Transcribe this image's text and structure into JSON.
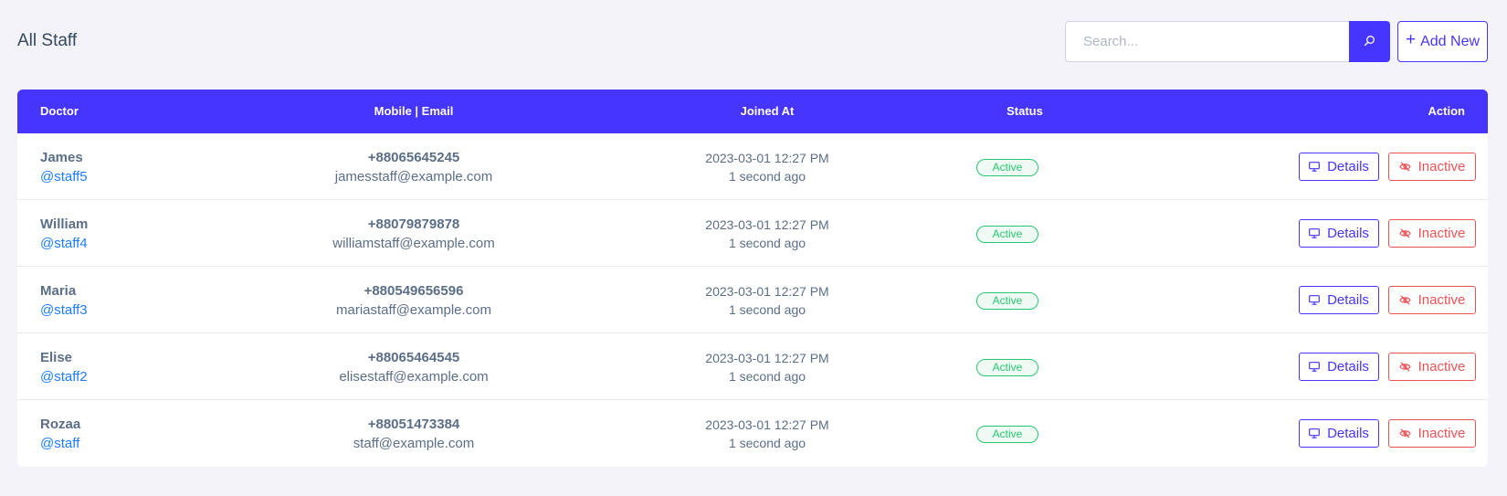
{
  "page": {
    "title": "All Staff"
  },
  "search": {
    "placeholder": "Search..."
  },
  "toolbar": {
    "add_label": "Add New",
    "add_icon": "plus-icon",
    "search_icon": "search-icon"
  },
  "colors": {
    "primary": "#4634ff",
    "success": "#28c76f",
    "danger": "#ea5455",
    "link": "#1e7cff",
    "background": "#f3f3f9"
  },
  "table": {
    "headers": {
      "doctor": "Doctor",
      "contact": "Mobile | Email",
      "joined": "Joined At",
      "status": "Status",
      "action": "Action"
    },
    "actions": {
      "details_label": "Details",
      "details_icon": "desktop-icon",
      "inactive_label": "Inactive",
      "inactive_icon": "eye-slash-icon"
    },
    "rows": [
      {
        "name": "James",
        "username": "@staff5",
        "mobile": "+88065645245",
        "email": "jamesstaff@example.com",
        "joined_date": "2023-03-01 12:27 PM",
        "joined_ago": "1 second ago",
        "status": "Active"
      },
      {
        "name": "William",
        "username": "@staff4",
        "mobile": "+88079879878",
        "email": "williamstaff@example.com",
        "joined_date": "2023-03-01 12:27 PM",
        "joined_ago": "1 second ago",
        "status": "Active"
      },
      {
        "name": "Maria",
        "username": "@staff3",
        "mobile": "+880549656596",
        "email": "mariastaff@example.com",
        "joined_date": "2023-03-01 12:27 PM",
        "joined_ago": "1 second ago",
        "status": "Active"
      },
      {
        "name": "Elise",
        "username": "@staff2",
        "mobile": "+88065464545",
        "email": "elisestaff@example.com",
        "joined_date": "2023-03-01 12:27 PM",
        "joined_ago": "1 second ago",
        "status": "Active"
      },
      {
        "name": "Rozaa",
        "username": "@staff",
        "mobile": "+88051473384",
        "email": "staff@example.com",
        "joined_date": "2023-03-01 12:27 PM",
        "joined_ago": "1 second ago",
        "status": "Active"
      }
    ]
  }
}
